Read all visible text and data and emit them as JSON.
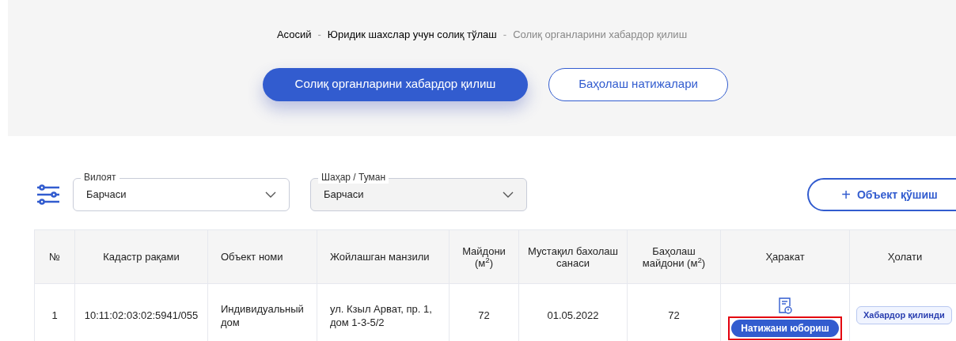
{
  "breadcrumbs": [
    {
      "label": "Асосий",
      "current": false
    },
    {
      "label": "Юридик шахслар учун солиқ тўлаш",
      "current": false
    },
    {
      "label": "Солиқ органларини хабардор қилиш",
      "current": true
    }
  ],
  "breadcrumb_separator": "-",
  "tabs": [
    {
      "label": "Солиқ органларини хабардор қилиш",
      "selected": true
    },
    {
      "label": "Баҳолаш натижалари",
      "selected": false
    }
  ],
  "filters": [
    {
      "label": "Вилоят",
      "value": "Барчаси",
      "disabled": false
    },
    {
      "label": "Шаҳар / Туман",
      "value": "Барчаси",
      "disabled": true
    }
  ],
  "add_button": {
    "icon": "+",
    "label": "Объект қўшиш"
  },
  "table": {
    "columns": [
      "№",
      "Кадастр рақами",
      "Объект номи",
      "Жойлашган манзили",
      "Майдони (м$^{2}$)",
      "Мустақил бахолаш санаси",
      "Баҳолаш майдони (м$^{2}$)",
      "Ҳаракат",
      "Ҳолати"
    ],
    "rows": [
      {
        "number": "1",
        "cadastre": "10:11:02:03:02:5941/055",
        "object": "Индивидуальный дом",
        "address": "ул. Кзыл Арват, пр. 1, дом 1-3-5/2",
        "area": "72",
        "date": "01.05.2022",
        "assessed_area": "72",
        "action": {
          "label": "Натижани юбориш",
          "highlighted": true
        },
        "status": "Хабардор қилинди"
      }
    ]
  }
}
